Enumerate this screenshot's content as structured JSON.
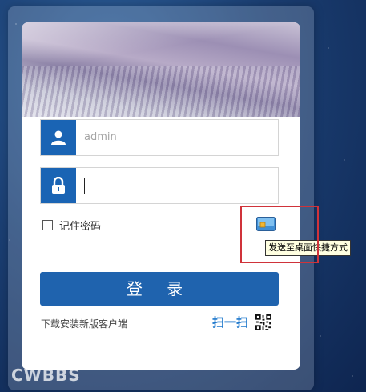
{
  "login": {
    "username_value": "admin",
    "password_value": "",
    "remember_label": "记住密码",
    "login_label": "登 录",
    "download_label": "下载安装新版客户端",
    "scan_label": "扫一扫"
  },
  "shortcut": {
    "tooltip": "发送至桌面快捷方式"
  },
  "watermark": "CWBBS",
  "colors": {
    "primary": "#1f63ae",
    "icon_bg": "#1a64b4",
    "scan_text": "#1e78cc",
    "highlight": "#d0333a"
  },
  "icons": [
    "user-icon",
    "lock-icon",
    "checkbox",
    "desktop-shortcut-icon",
    "qr-code-icon"
  ]
}
